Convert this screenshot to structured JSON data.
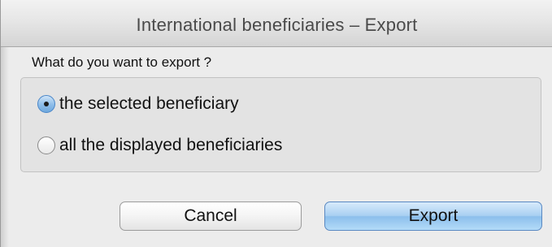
{
  "dialog": {
    "title": "International beneficiaries – Export",
    "prompt": "What do you want to export ?"
  },
  "options": [
    {
      "label": "the selected beneficiary",
      "selected": true
    },
    {
      "label": "all the displayed beneficiaries",
      "selected": false
    }
  ],
  "buttons": {
    "cancel_label": "Cancel",
    "export_label": "Export"
  },
  "colors": {
    "window_bg": "#ececec",
    "default_button": "#a9d0f2",
    "radio_selected": "#8dbde9"
  }
}
